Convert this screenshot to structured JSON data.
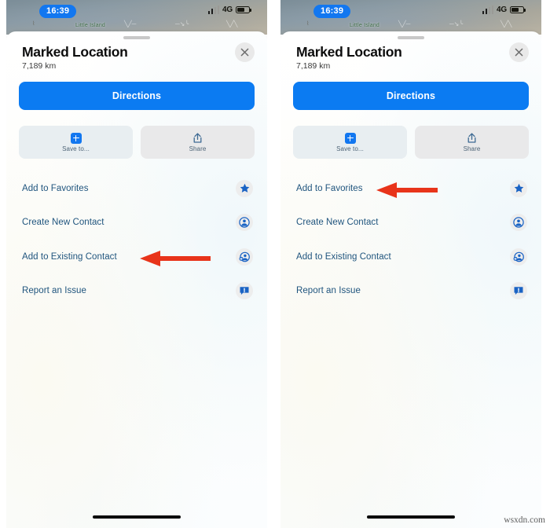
{
  "meta": {
    "watermark": "wsxdn.com"
  },
  "colors": {
    "accent_blue": "#0b7bf2",
    "time_pill_blue": "#1277f0",
    "list_label_blue": "#20557e",
    "icon_blue": "#1a63c4",
    "arrow_red": "#e8341a",
    "tile_grey": "#e9e9ea",
    "tile_tinted": "#e8eef1"
  },
  "panels": [
    {
      "id": "left",
      "status_bar": {
        "time": "16:39",
        "network": "4G",
        "signal_icon": "cellular-bars-icon",
        "battery_icon": "battery-icon",
        "battery_level": 62
      },
      "map": {
        "label": "Little Island",
        "tick_glyph": "⌇",
        "scribbles": [
          "╲╱─",
          "─↘╰",
          "╲╱╲"
        ]
      },
      "card": {
        "grabber_icon": "drag-handle-icon",
        "title": "Marked Location",
        "subtitle": "7,189 km",
        "close_icon": "close-icon",
        "primary_button": "Directions",
        "tiles": [
          {
            "label": "Save to...",
            "icon": "plus-square-icon",
            "tinted": true
          },
          {
            "label": "Share",
            "icon": "share-icon",
            "tinted": false
          }
        ],
        "rows": [
          {
            "label": "Add to Favorites",
            "icon": "star-icon",
            "highlighted": false
          },
          {
            "label": "Create New Contact",
            "icon": "person-circle-icon",
            "highlighted": false
          },
          {
            "label": "Add to Existing Contact",
            "icon": "person-add-icon",
            "highlighted": true
          },
          {
            "label": "Report an Issue",
            "icon": "speech-bubble-exclamation-icon",
            "highlighted": false
          }
        ]
      },
      "annotation": {
        "target_row": "Add to Existing Contact",
        "direction": "left",
        "color": "#e8341a"
      },
      "home_indicator": "home-bar"
    },
    {
      "id": "right",
      "status_bar": {
        "time": "16:39",
        "network": "4G",
        "signal_icon": "cellular-bars-icon",
        "battery_icon": "battery-icon",
        "battery_level": 62
      },
      "map": {
        "label": "Little Island",
        "tick_glyph": "⌇",
        "scribbles": [
          "╲╱─",
          "─↘╰",
          "╲╱╲"
        ]
      },
      "card": {
        "grabber_icon": "drag-handle-icon",
        "title": "Marked Location",
        "subtitle": "7,189 km",
        "close_icon": "close-icon",
        "primary_button": "Directions",
        "tiles": [
          {
            "label": "Save to...",
            "icon": "plus-square-icon",
            "tinted": true
          },
          {
            "label": "Share",
            "icon": "share-icon",
            "tinted": false
          }
        ],
        "rows": [
          {
            "label": "Add to Favorites",
            "icon": "star-icon",
            "highlighted": true
          },
          {
            "label": "Create New Contact",
            "icon": "person-circle-icon",
            "highlighted": false
          },
          {
            "label": "Add to Existing Contact",
            "icon": "person-add-icon",
            "highlighted": false
          },
          {
            "label": "Report an Issue",
            "icon": "speech-bubble-exclamation-icon",
            "highlighted": false
          }
        ]
      },
      "annotation": {
        "target_row": "Add to Favorites",
        "direction": "left",
        "color": "#e8341a"
      },
      "home_indicator": "home-bar"
    }
  ]
}
